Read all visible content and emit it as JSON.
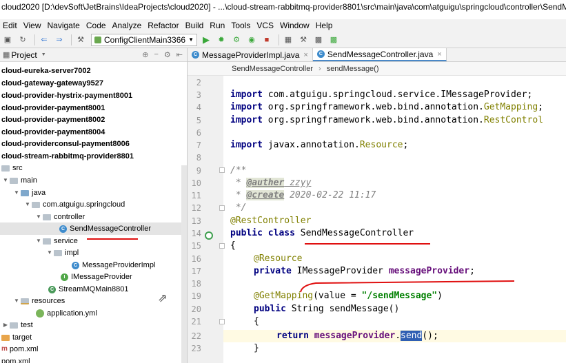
{
  "window": {
    "title": "cloud2020 [D:\\devSoft\\JetBrains\\IdeaProjects\\cloud2020] - ...\\cloud-stream-rabbitmq-provider8801\\src\\main\\java\\com\\atguigu\\springcloud\\controller\\SendMessageCont"
  },
  "menu": [
    "Edit",
    "View",
    "Navigate",
    "Code",
    "Analyze",
    "Refactor",
    "Build",
    "Run",
    "Tools",
    "VCS",
    "Window",
    "Help"
  ],
  "toolbar": {
    "run_config": "ConfigClientMain3366"
  },
  "project_panel": {
    "label": "Project"
  },
  "tree": [
    {
      "label": "cloud-eureka-server7002"
    },
    {
      "label": "cloud-gateway-gateway9527"
    },
    {
      "label": "cloud-provider-hystrix-payment8001"
    },
    {
      "label": "cloud-provider-payment8001"
    },
    {
      "label": "cloud-provider-payment8002"
    },
    {
      "label": "cloud-provider-payment8004"
    },
    {
      "label": "cloud-providerconsul-payment8006"
    },
    {
      "label": "cloud-stream-rabbitmq-provider8801"
    },
    {
      "label": "src"
    },
    {
      "label": "main"
    },
    {
      "label": "java"
    },
    {
      "label": "com.atguigu.springcloud"
    },
    {
      "label": "controller"
    },
    {
      "label": "SendMessageController"
    },
    {
      "label": "service"
    },
    {
      "label": "impl"
    },
    {
      "label": "MessageProviderImpl"
    },
    {
      "label": "IMessageProvider"
    },
    {
      "label": "StreamMQMain8801"
    },
    {
      "label": "resources"
    },
    {
      "label": "application.yml"
    },
    {
      "label": "test"
    },
    {
      "label": "target"
    },
    {
      "label": "pom.xml"
    },
    {
      "label": "pom.xml"
    }
  ],
  "tabs": [
    {
      "label": "MessageProviderImpl.java",
      "active": false
    },
    {
      "label": "SendMessageController.java",
      "active": true
    }
  ],
  "breadcrumb": [
    "SendMessageController",
    "sendMessage()"
  ],
  "editor": {
    "line_numbers": [
      "2",
      "3",
      "4",
      "5",
      "6",
      "7",
      "8",
      "9",
      "10",
      "11",
      "12",
      "13",
      "14",
      "15",
      "16",
      "17",
      "18",
      "19",
      "20",
      "21",
      "22",
      "23"
    ],
    "imports": {
      "kw": "import",
      "l3a": " com.atguigu.springcloud.service.IMessageProvider;",
      "l4a": " org.springframework.web.bind.annotation.",
      "l4b": "GetMapping",
      "l4c": ";",
      "l5a": " org.springframework.web.bind.annotation.",
      "l5b": "RestControl",
      "l7a": " javax.annotation.",
      "l7b": "Resource",
      "l7c": ";"
    },
    "javadoc": {
      "open": "/**",
      "star": " * ",
      "auther_tag": "@auther",
      "auther_val": " zzyy",
      "create_tag": "@create",
      "create_val": " 2020-02-22 11:17",
      "close": " */"
    },
    "class_decl": {
      "annotation": "@RestController",
      "kw1": "public class",
      "name": " SendMessageController",
      "brace_open": "{",
      "resource": "@Resource",
      "private_kw": "private",
      "field_type": " IMessageProvider ",
      "field_name": "messageProvider",
      "semi": ";",
      "getmapping": "@GetMapping",
      "gm_args_a": "(value = ",
      "gm_str": "\"/sendMessage\"",
      "gm_args_b": ")",
      "public_kw": "public",
      "method_sig": " String sendMessage()",
      "inner_open": "{",
      "return_kw": "return",
      "call_obj": "messageProvider",
      "dot": ".",
      "call_sel": "send",
      "call_end": "();",
      "inner_close": "}"
    }
  }
}
